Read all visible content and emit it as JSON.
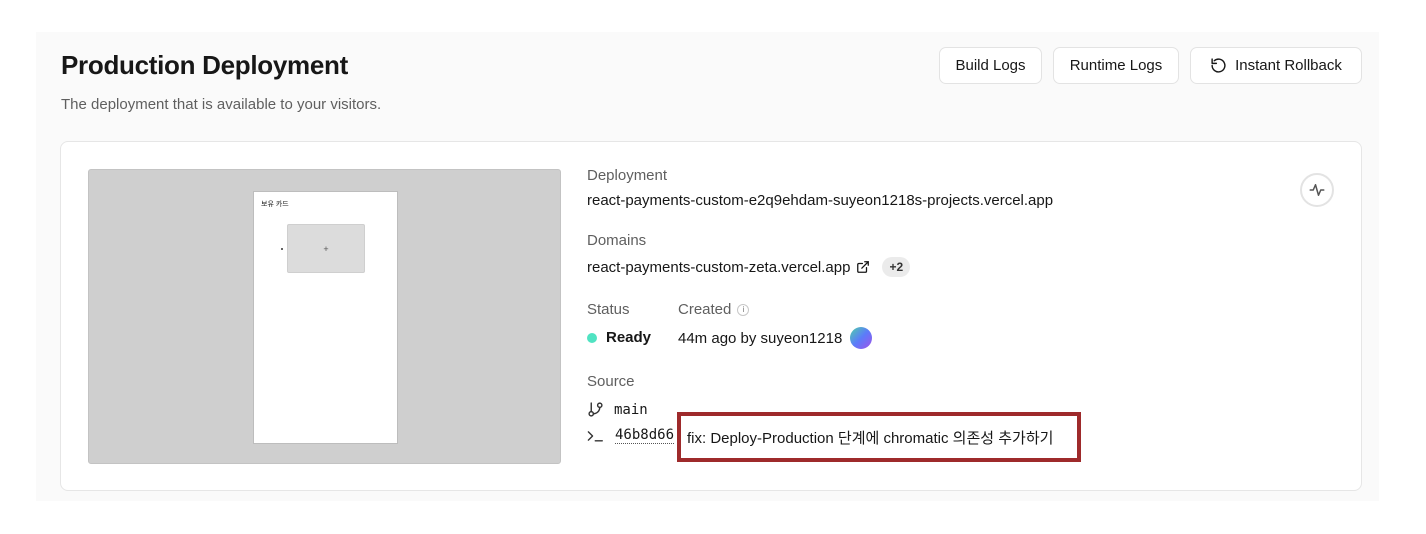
{
  "header": {
    "title": "Production Deployment",
    "subtitle": "The deployment that is available to your visitors.",
    "buttons": {
      "build_logs": "Build Logs",
      "runtime_logs": "Runtime Logs",
      "instant_rollback": "Instant Rollback"
    }
  },
  "preview": {
    "page_title": "보유 카드",
    "add_symbol": "+"
  },
  "deployment": {
    "label": "Deployment",
    "url": "react-payments-custom-e2q9ehdam-suyeon1218s-projects.vercel.app"
  },
  "domains": {
    "label": "Domains",
    "primary": "react-payments-custom-zeta.vercel.app",
    "more_count": "+2"
  },
  "status": {
    "label": "Status",
    "value": "Ready",
    "color": "#50e3c2"
  },
  "created": {
    "label": "Created",
    "info_symbol": "i",
    "value": "44m ago by suyeon1218"
  },
  "source": {
    "label": "Source",
    "branch": "main",
    "commit_hash": "46b8d66",
    "commit_message": "fix: Deploy-Production 단계에 chromatic 의존성 추가하기"
  },
  "icons": {
    "rollback": "rollback-icon",
    "external_link": "external-link-icon",
    "branch": "git-branch-icon",
    "commit": "terminal-icon",
    "activity": "activity-icon"
  },
  "highlight_color": "#9e2a2b"
}
